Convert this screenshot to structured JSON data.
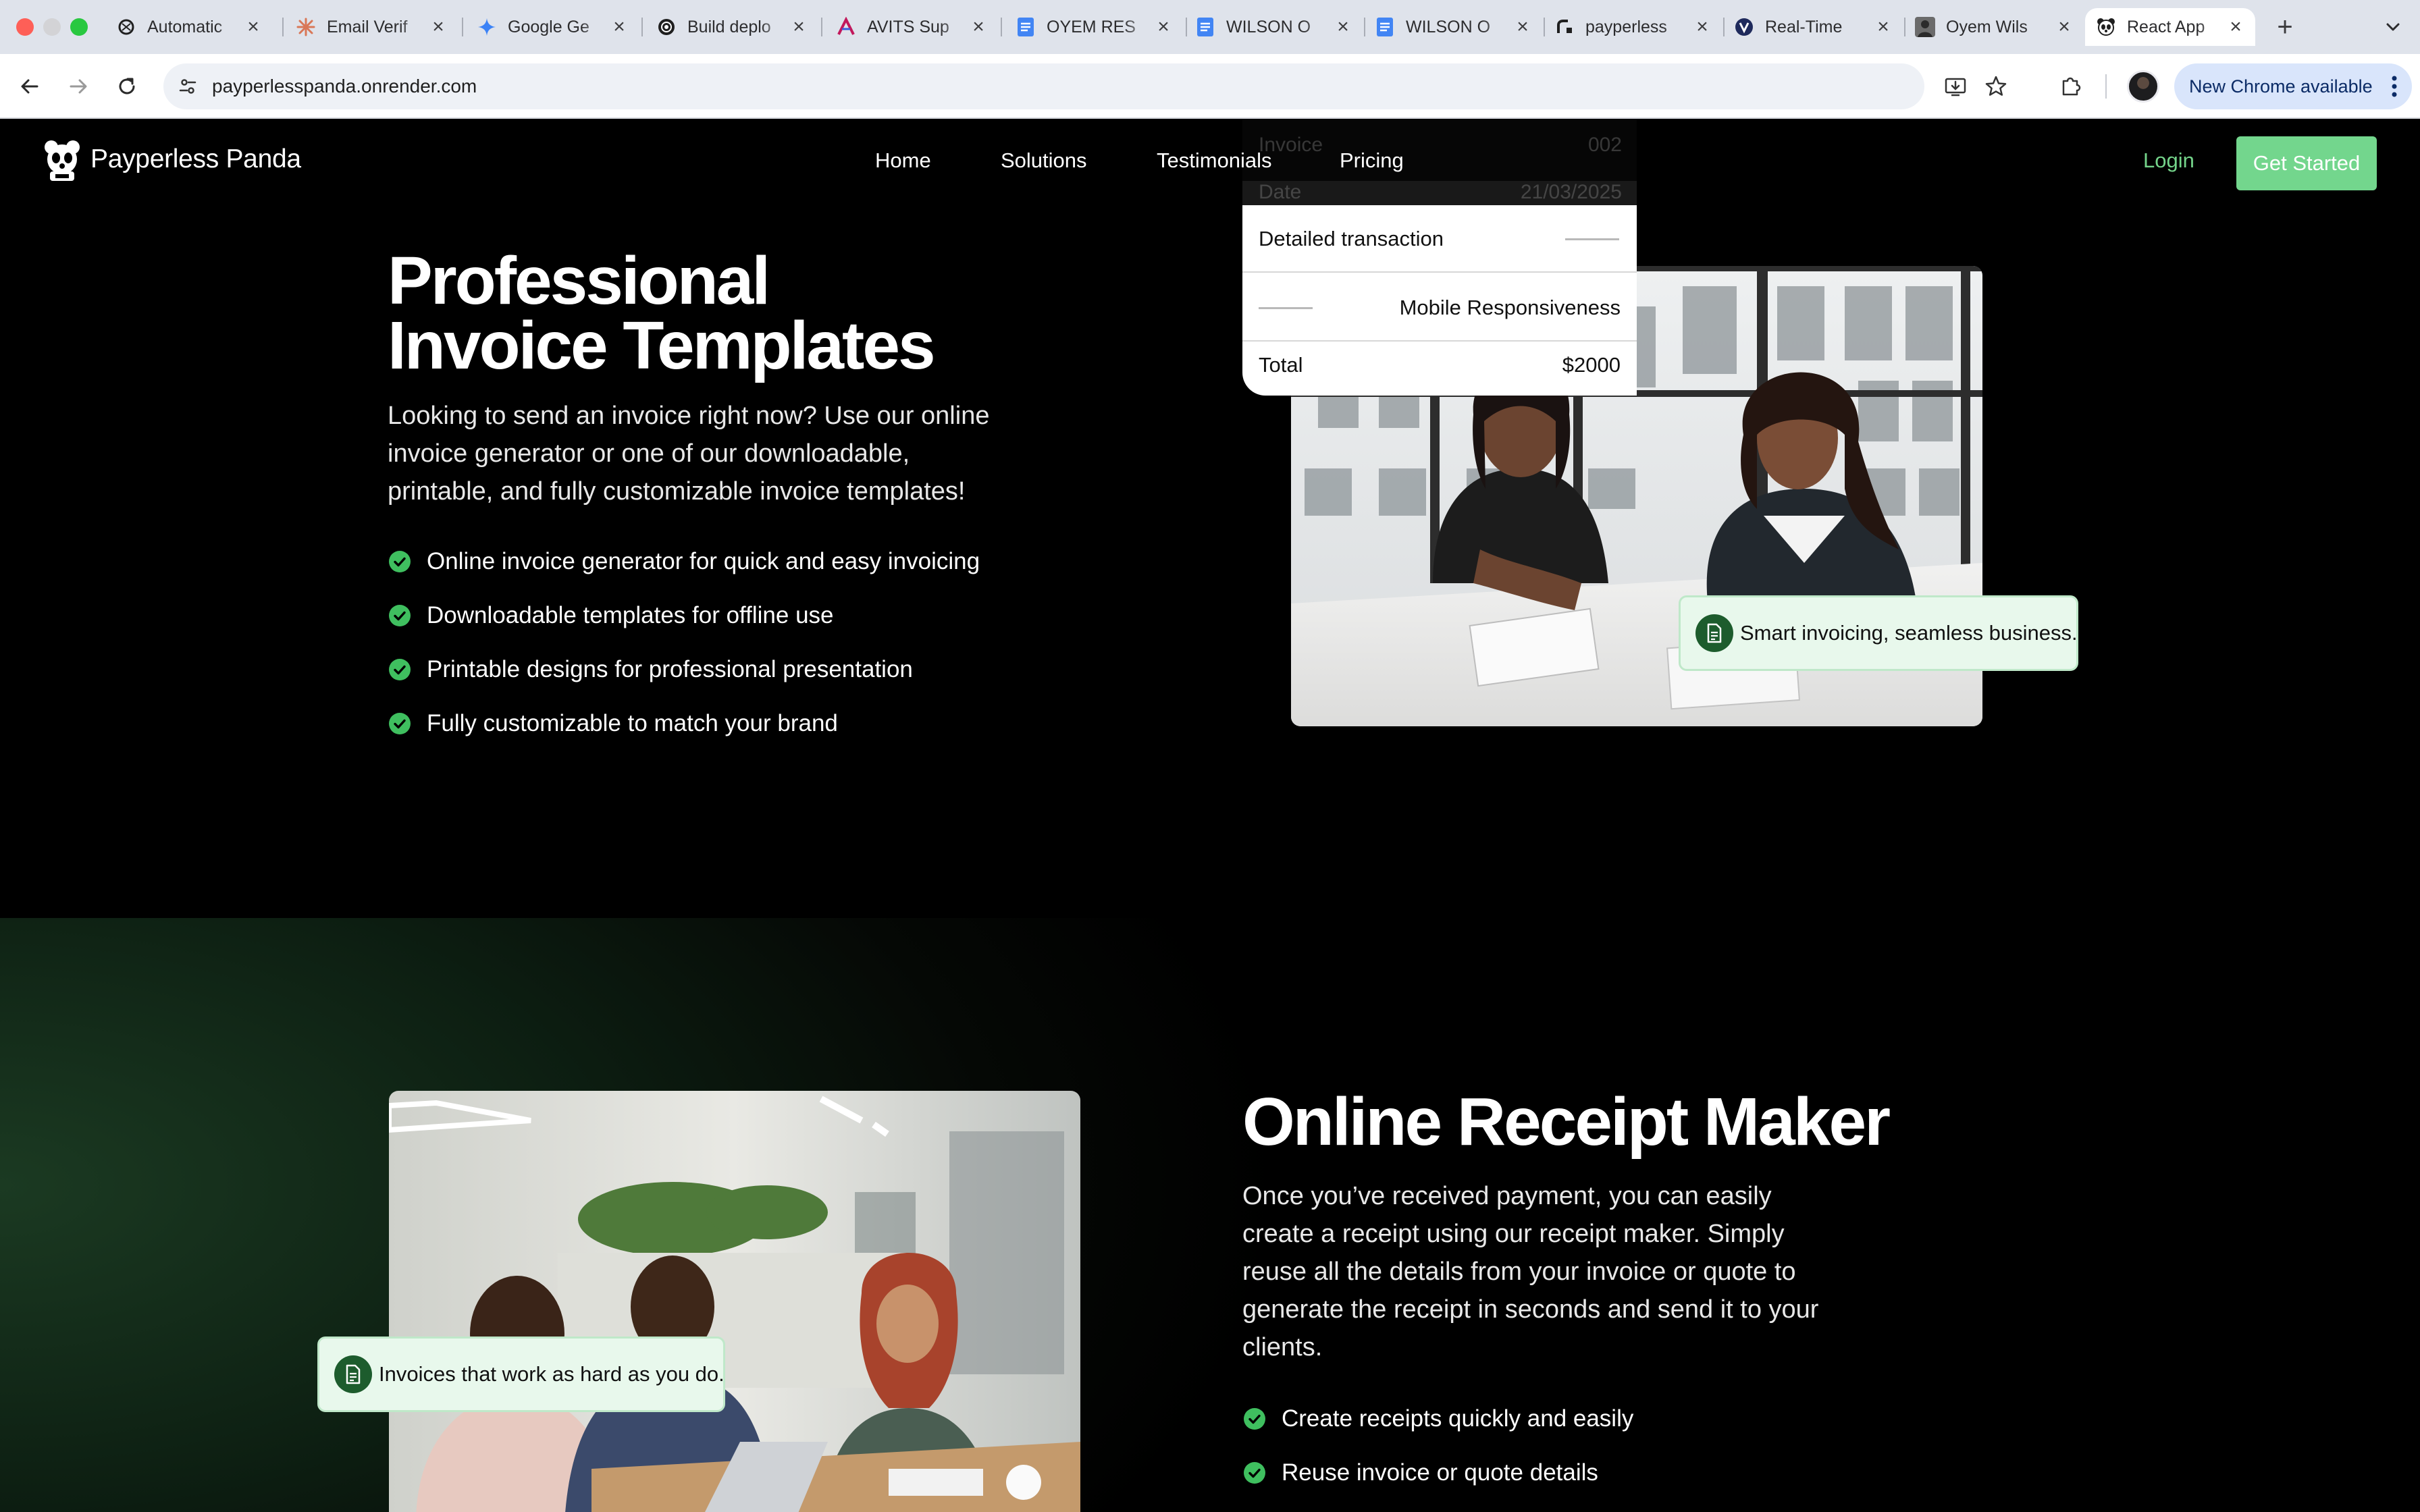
{
  "browser": {
    "tabs": [
      {
        "title": "Automatic",
        "icon": "openai-icon",
        "color": "#1f1f1f"
      },
      {
        "title": "Email Verif",
        "icon": "claude-icon",
        "color": "#d97757"
      },
      {
        "title": "Google Ge",
        "icon": "gemini-icon",
        "color": "#3b82f6"
      },
      {
        "title": "Build deplo",
        "icon": "render-icon",
        "color": "#1f1f1f"
      },
      {
        "title": "AVITS Sup",
        "icon": "avits-icon",
        "color": "#c2185b"
      },
      {
        "title": "OYEM RES",
        "icon": "google-docs-icon",
        "color": "#4285f4"
      },
      {
        "title": "WILSON O",
        "icon": "google-docs-icon",
        "color": "#4285f4"
      },
      {
        "title": "WILSON O",
        "icon": "google-docs-icon",
        "color": "#4285f4"
      },
      {
        "title": "payperless",
        "icon": "render-logo-icon",
        "color": "#1f1f1f"
      },
      {
        "title": "Real-Time",
        "icon": "realtime-icon",
        "color": "#1f2a5c"
      },
      {
        "title": "Oyem Wils",
        "icon": "profile-photo-icon",
        "color": "#555555"
      },
      {
        "title": "React App",
        "icon": "panda-icon",
        "color": "#1f1f1f"
      }
    ],
    "new_tab_label": "+",
    "url": "payperlesspanda.onrender.com",
    "update_label": "New Chrome available"
  },
  "site": {
    "brand": "Payperless Panda",
    "nav": [
      "Home",
      "Solutions",
      "Testimonials",
      "Pricing"
    ],
    "login": "Login",
    "cta": "Get Started"
  },
  "hero": {
    "title": "Professional Invoice Templates",
    "lead": "Looking to send an invoice right now? Use our online invoice generator or one of our downloadable, printable, and fully customizable invoice templates!",
    "features": [
      "Online invoice generator for quick and easy invoicing",
      "Downloadable templates for offline use",
      "Printable designs for professional presentation",
      "Fully customizable to match your brand"
    ],
    "invoice_card": {
      "ghost_rows": [
        {
          "label": "Invoice",
          "value": "002"
        },
        {
          "label": "Date",
          "value": "21/03/2025"
        }
      ],
      "row1_label": "Detailed transaction",
      "row2_label": "Mobile Responsiveness",
      "total_label": "Total",
      "total_value": "$2000"
    },
    "badge": "Smart invoicing, seamless business."
  },
  "receipt": {
    "title": "Online Receipt Maker",
    "lead": "Once you’ve received payment, you can easily create a receipt using our receipt maker. Simply reuse all the details from your invoice or quote to generate the receipt in seconds and send it to your clients.",
    "features": [
      "Create receipts quickly and easily",
      "Reuse invoice or quote details"
    ],
    "badge": "Invoices that work as hard as you do."
  },
  "colors": {
    "accent_green": "#73d68d",
    "check_green": "#3fbf5f",
    "badge_bg": "#e8f8ec",
    "chrome_update_bg": "#d9e5fb"
  }
}
